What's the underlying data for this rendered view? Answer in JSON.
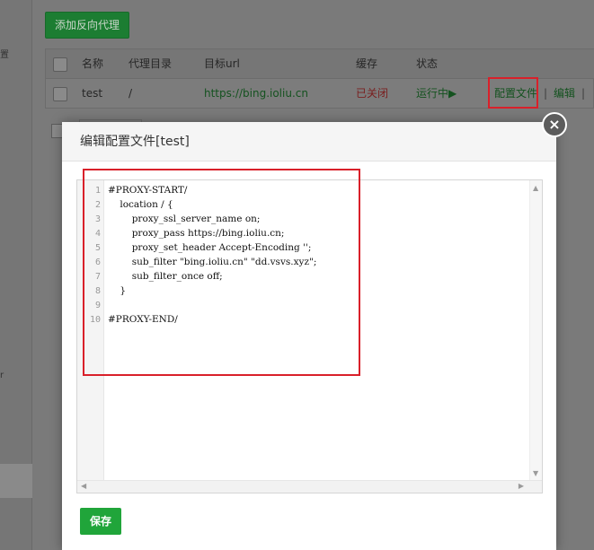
{
  "background": {
    "add_button": "添加反向代理",
    "table": {
      "headers": [
        "名称",
        "代理目录",
        "目标url",
        "缓存",
        "状态"
      ],
      "row": {
        "name": "test",
        "dir": "/",
        "url": "https://bing.ioliu.cn",
        "cache": "已关闭",
        "status": "运行中▶",
        "action_config": "配置文件",
        "sep": "|",
        "action_edit": "编辑",
        "sep2": "|"
      }
    },
    "left_fragments": [
      "置",
      "r"
    ]
  },
  "modal": {
    "title": "编辑配置文件[test]",
    "close_symbol": "×",
    "line_numbers": [
      "1",
      "2",
      "3",
      "4",
      "5",
      "6",
      "7",
      "8",
      "9",
      "10"
    ],
    "code_lines": [
      "#PROXY-START/",
      "    location / {",
      "        proxy_ssl_server_name on;",
      "        proxy_pass https://bing.ioliu.cn;",
      "        proxy_set_header Accept-Encoding '';",
      "        sub_filter \"bing.ioliu.cn\" \"dd.vsvs.xyz\";",
      "        sub_filter_once off;",
      "    }",
      "",
      "#PROXY-END/"
    ],
    "save_button": "保存"
  },
  "colors": {
    "accent": "#20a53a",
    "highlight_box": "#d9202a"
  }
}
